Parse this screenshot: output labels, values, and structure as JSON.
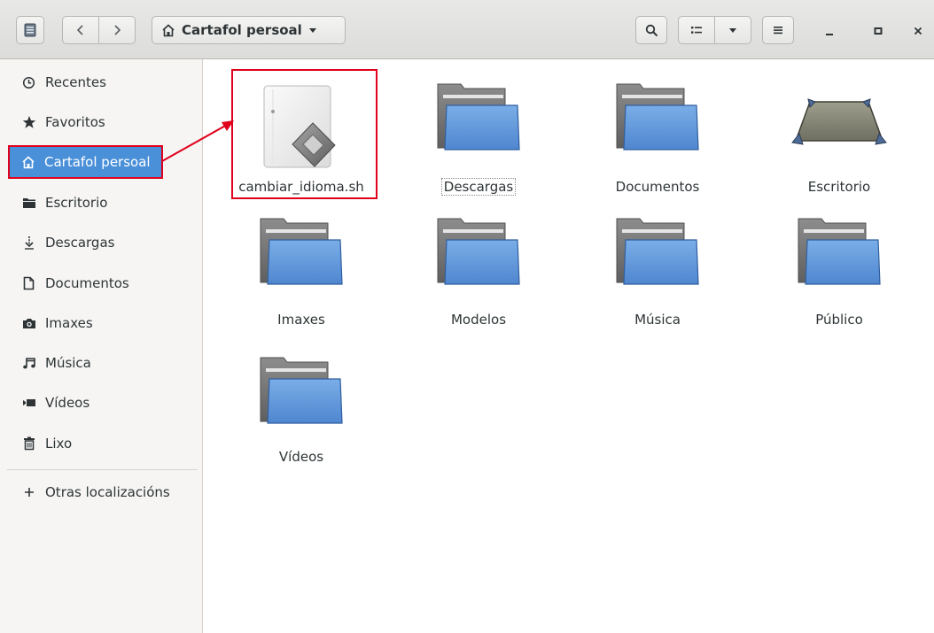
{
  "header": {
    "path_label": "Cartafol persoal",
    "path_icon": "home-icon",
    "buttons": [
      "sidebar-toggle",
      "back",
      "forward",
      "search",
      "view-grid",
      "view-options",
      "menu",
      "minimize",
      "maximize",
      "close"
    ]
  },
  "sidebar": {
    "items": [
      {
        "label": "Recentes",
        "icon": "clock-icon"
      },
      {
        "label": "Favoritos",
        "icon": "star-icon"
      },
      {
        "label": "Cartafol persoal",
        "icon": "home-icon",
        "active": true
      },
      {
        "label": "Escritorio",
        "icon": "folder-icon"
      },
      {
        "label": "Descargas",
        "icon": "download-icon"
      },
      {
        "label": "Documentos",
        "icon": "document-icon"
      },
      {
        "label": "Imaxes",
        "icon": "camera-icon"
      },
      {
        "label": "Música",
        "icon": "music-icon"
      },
      {
        "label": "Vídeos",
        "icon": "video-icon"
      },
      {
        "label": "Lixo",
        "icon": "trash-icon"
      }
    ],
    "other_locations": {
      "label": "Otras localizacións",
      "icon": "plus-icon"
    }
  },
  "files": [
    {
      "name": "cambiar_idioma.sh",
      "type": "script"
    },
    {
      "name": "Descargas",
      "type": "folder"
    },
    {
      "name": "Documentos",
      "type": "folder"
    },
    {
      "name": "Escritorio",
      "type": "desktop"
    },
    {
      "name": "Imaxes",
      "type": "folder"
    },
    {
      "name": "Modelos",
      "type": "folder"
    },
    {
      "name": "Música",
      "type": "folder"
    },
    {
      "name": "Público",
      "type": "folder"
    },
    {
      "name": "Vídeos",
      "type": "folder"
    }
  ],
  "colors": {
    "accent": "#4a90d9",
    "annotation": "#e0001b",
    "folder_blue": "#5b92d6"
  }
}
